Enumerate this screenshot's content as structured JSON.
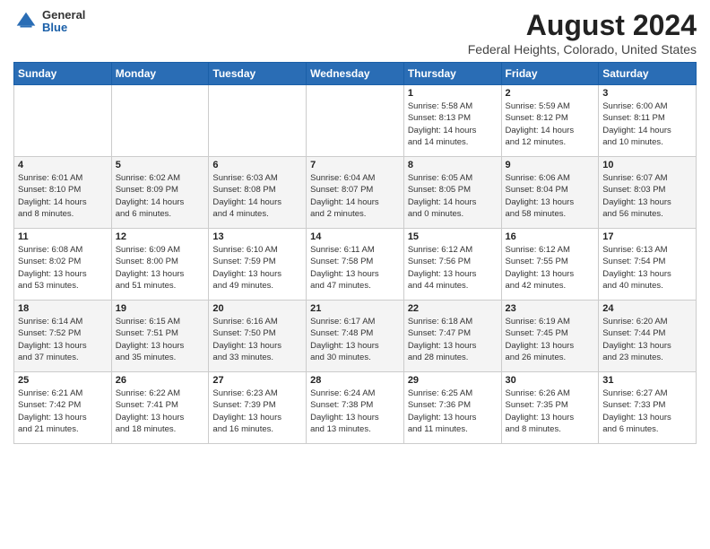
{
  "logo": {
    "general": "General",
    "blue": "Blue"
  },
  "title": "August 2024",
  "subtitle": "Federal Heights, Colorado, United States",
  "days_header": [
    "Sunday",
    "Monday",
    "Tuesday",
    "Wednesday",
    "Thursday",
    "Friday",
    "Saturday"
  ],
  "weeks": [
    [
      {
        "num": "",
        "info": ""
      },
      {
        "num": "",
        "info": ""
      },
      {
        "num": "",
        "info": ""
      },
      {
        "num": "",
        "info": ""
      },
      {
        "num": "1",
        "info": "Sunrise: 5:58 AM\nSunset: 8:13 PM\nDaylight: 14 hours\nand 14 minutes."
      },
      {
        "num": "2",
        "info": "Sunrise: 5:59 AM\nSunset: 8:12 PM\nDaylight: 14 hours\nand 12 minutes."
      },
      {
        "num": "3",
        "info": "Sunrise: 6:00 AM\nSunset: 8:11 PM\nDaylight: 14 hours\nand 10 minutes."
      }
    ],
    [
      {
        "num": "4",
        "info": "Sunrise: 6:01 AM\nSunset: 8:10 PM\nDaylight: 14 hours\nand 8 minutes."
      },
      {
        "num": "5",
        "info": "Sunrise: 6:02 AM\nSunset: 8:09 PM\nDaylight: 14 hours\nand 6 minutes."
      },
      {
        "num": "6",
        "info": "Sunrise: 6:03 AM\nSunset: 8:08 PM\nDaylight: 14 hours\nand 4 minutes."
      },
      {
        "num": "7",
        "info": "Sunrise: 6:04 AM\nSunset: 8:07 PM\nDaylight: 14 hours\nand 2 minutes."
      },
      {
        "num": "8",
        "info": "Sunrise: 6:05 AM\nSunset: 8:05 PM\nDaylight: 14 hours\nand 0 minutes."
      },
      {
        "num": "9",
        "info": "Sunrise: 6:06 AM\nSunset: 8:04 PM\nDaylight: 13 hours\nand 58 minutes."
      },
      {
        "num": "10",
        "info": "Sunrise: 6:07 AM\nSunset: 8:03 PM\nDaylight: 13 hours\nand 56 minutes."
      }
    ],
    [
      {
        "num": "11",
        "info": "Sunrise: 6:08 AM\nSunset: 8:02 PM\nDaylight: 13 hours\nand 53 minutes."
      },
      {
        "num": "12",
        "info": "Sunrise: 6:09 AM\nSunset: 8:00 PM\nDaylight: 13 hours\nand 51 minutes."
      },
      {
        "num": "13",
        "info": "Sunrise: 6:10 AM\nSunset: 7:59 PM\nDaylight: 13 hours\nand 49 minutes."
      },
      {
        "num": "14",
        "info": "Sunrise: 6:11 AM\nSunset: 7:58 PM\nDaylight: 13 hours\nand 47 minutes."
      },
      {
        "num": "15",
        "info": "Sunrise: 6:12 AM\nSunset: 7:56 PM\nDaylight: 13 hours\nand 44 minutes."
      },
      {
        "num": "16",
        "info": "Sunrise: 6:12 AM\nSunset: 7:55 PM\nDaylight: 13 hours\nand 42 minutes."
      },
      {
        "num": "17",
        "info": "Sunrise: 6:13 AM\nSunset: 7:54 PM\nDaylight: 13 hours\nand 40 minutes."
      }
    ],
    [
      {
        "num": "18",
        "info": "Sunrise: 6:14 AM\nSunset: 7:52 PM\nDaylight: 13 hours\nand 37 minutes."
      },
      {
        "num": "19",
        "info": "Sunrise: 6:15 AM\nSunset: 7:51 PM\nDaylight: 13 hours\nand 35 minutes."
      },
      {
        "num": "20",
        "info": "Sunrise: 6:16 AM\nSunset: 7:50 PM\nDaylight: 13 hours\nand 33 minutes."
      },
      {
        "num": "21",
        "info": "Sunrise: 6:17 AM\nSunset: 7:48 PM\nDaylight: 13 hours\nand 30 minutes."
      },
      {
        "num": "22",
        "info": "Sunrise: 6:18 AM\nSunset: 7:47 PM\nDaylight: 13 hours\nand 28 minutes."
      },
      {
        "num": "23",
        "info": "Sunrise: 6:19 AM\nSunset: 7:45 PM\nDaylight: 13 hours\nand 26 minutes."
      },
      {
        "num": "24",
        "info": "Sunrise: 6:20 AM\nSunset: 7:44 PM\nDaylight: 13 hours\nand 23 minutes."
      }
    ],
    [
      {
        "num": "25",
        "info": "Sunrise: 6:21 AM\nSunset: 7:42 PM\nDaylight: 13 hours\nand 21 minutes."
      },
      {
        "num": "26",
        "info": "Sunrise: 6:22 AM\nSunset: 7:41 PM\nDaylight: 13 hours\nand 18 minutes."
      },
      {
        "num": "27",
        "info": "Sunrise: 6:23 AM\nSunset: 7:39 PM\nDaylight: 13 hours\nand 16 minutes."
      },
      {
        "num": "28",
        "info": "Sunrise: 6:24 AM\nSunset: 7:38 PM\nDaylight: 13 hours\nand 13 minutes."
      },
      {
        "num": "29",
        "info": "Sunrise: 6:25 AM\nSunset: 7:36 PM\nDaylight: 13 hours\nand 11 minutes."
      },
      {
        "num": "30",
        "info": "Sunrise: 6:26 AM\nSunset: 7:35 PM\nDaylight: 13 hours\nand 8 minutes."
      },
      {
        "num": "31",
        "info": "Sunrise: 6:27 AM\nSunset: 7:33 PM\nDaylight: 13 hours\nand 6 minutes."
      }
    ]
  ]
}
